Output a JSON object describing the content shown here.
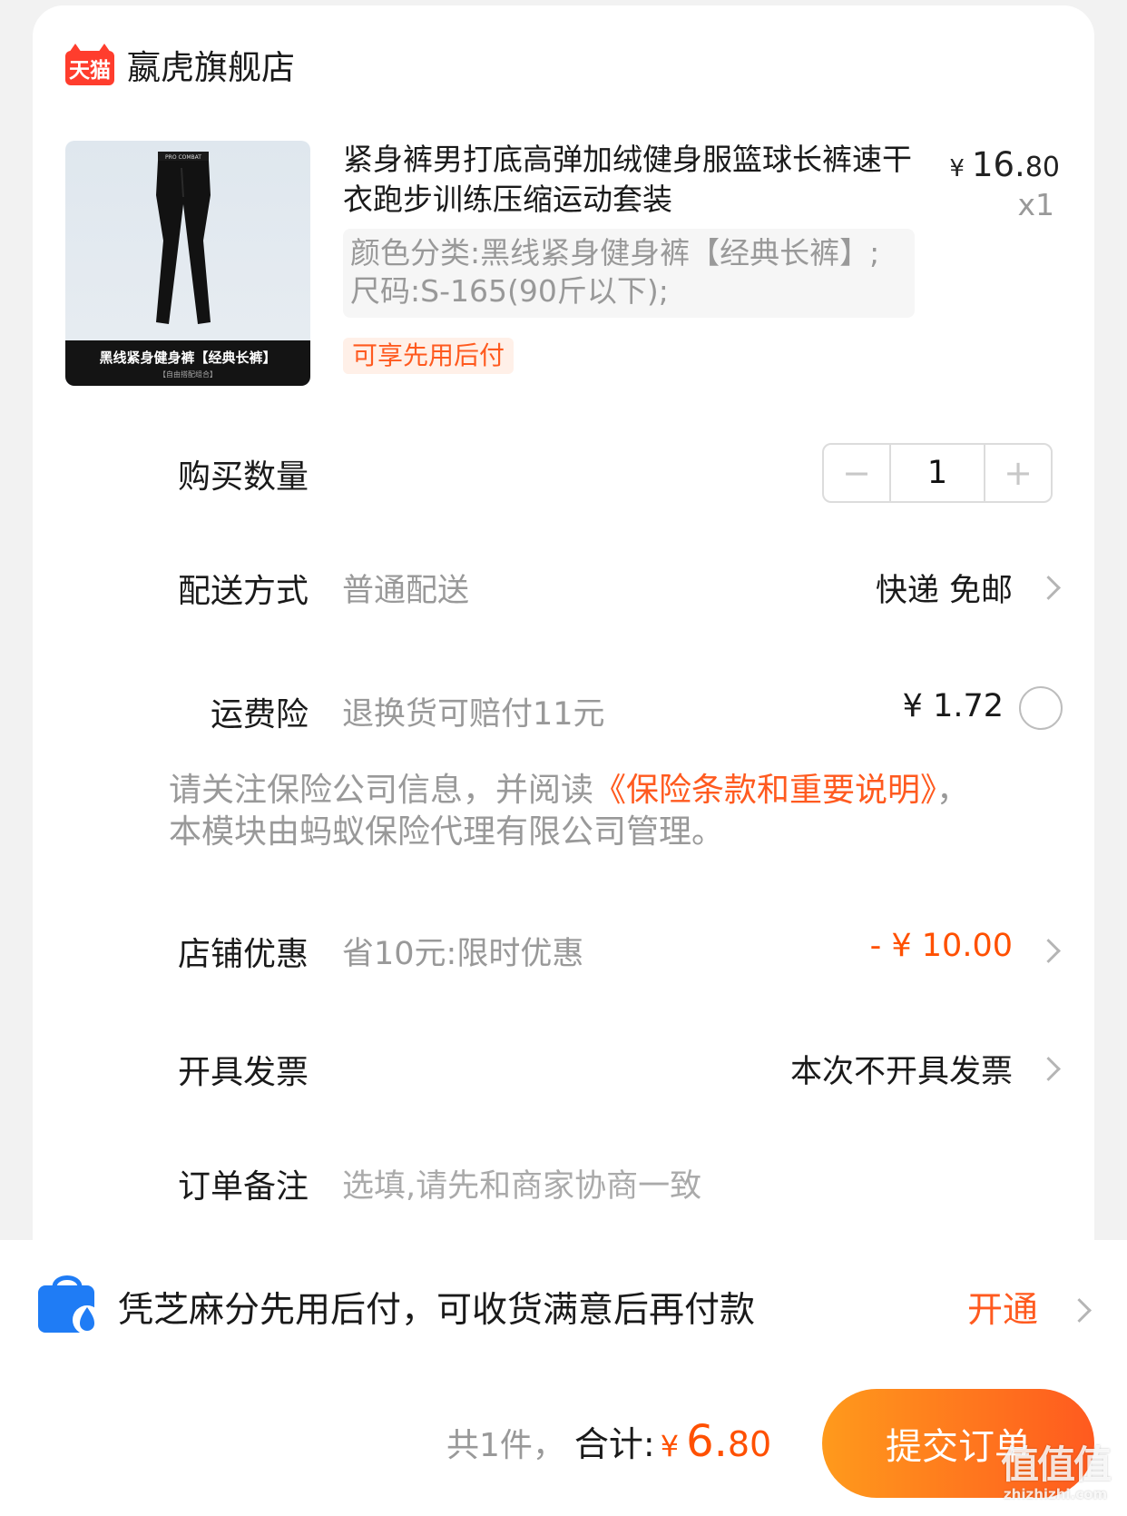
{
  "shop": {
    "badge": "天猫",
    "name": "嬴虎旗舰店"
  },
  "product": {
    "image_caption": "黑线紧身健身裤【经典长裤】",
    "image_subcaption": "【自由搭配组合】",
    "image_brand": "PRO COMBAT",
    "title": "紧身裤男打底高弹加绒健身服篮球长裤速干衣跑步训练压缩运动套装",
    "price_symbol": "¥",
    "price_int": "16.",
    "price_dec": "80",
    "quantity_label": "x1",
    "sku": "颜色分类:黑线紧身健身裤【经典长裤】;尺码:S-165(90斤以下);",
    "tag": "可享先用后付"
  },
  "quantity": {
    "label": "购买数量",
    "minus": "−",
    "value": "1",
    "plus": "+"
  },
  "delivery": {
    "label": "配送方式",
    "desc": "普通配送",
    "value": "快递 免邮"
  },
  "insurance": {
    "label": "运费险",
    "desc": "退换货可赔付11元",
    "price": "¥ 1.72"
  },
  "notice": {
    "prefix": "请关注保险公司信息，并阅读",
    "link": "《保险条款和重要说明》",
    "suffix": "，本模块由蚂蚁保险代理有限公司管理。"
  },
  "discount": {
    "label": "店铺优惠",
    "desc": "省10元:限时优惠",
    "value": "- ¥ 10.00"
  },
  "invoice": {
    "label": "开具发票",
    "value": "本次不开具发票"
  },
  "remark": {
    "label": "订单备注",
    "placeholder": "选填,请先和商家协商一致"
  },
  "pay_later": {
    "text": "凭芝麻分先用后付，可收货满意后再付款",
    "action": "开通"
  },
  "footer": {
    "count": "共1件，",
    "total_label": "合计:",
    "total_symbol": "¥",
    "total_int": "6.",
    "total_dec": "80",
    "submit": "提交订单"
  },
  "watermark": {
    "logo": "值值值",
    "site": "zhizhizhi.com"
  },
  "colors": {
    "accent": "#ff5000",
    "tmall_red": "#ff3d2d",
    "pay_blue": "#1f7cf5"
  }
}
